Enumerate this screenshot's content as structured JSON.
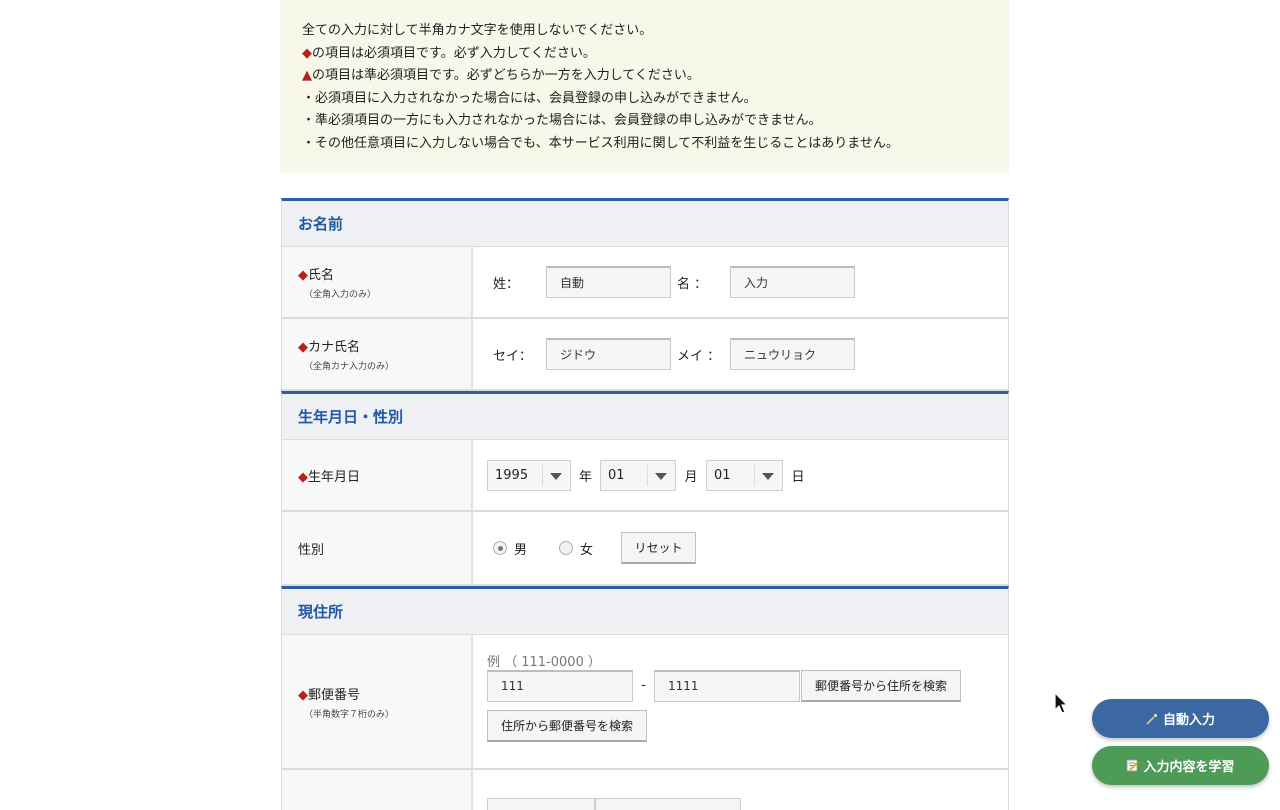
{
  "notice": {
    "line1": "全ての入力に対して半角カナ文字を使用しないでください。",
    "line2_mark": "◆",
    "line2": "の項目は必須項目です。必ず入力してください。",
    "line3_mark": "▲",
    "line3": "の項目は準必須項目です。必ずどちらか一方を入力してください。",
    "line4": "・必須項目に入力されなかった場合には、会員登録の申し込みができません。",
    "line5": "・準必須項目の一方にも入力されなかった場合には、会員登録の申し込みができません。",
    "line6": "・その他任意項目に入力しない場合でも、本サービス利用に関して不利益を生じることはありません。"
  },
  "sections": {
    "name": "お名前",
    "birth": "生年月日・性別",
    "address": "現住所"
  },
  "name_row": {
    "mark": "◆",
    "label": "氏名",
    "sub": "（全角入力のみ）",
    "sei_label": "姓：",
    "sei_value": "自動",
    "mei_label": "名 ：",
    "mei_value": "入力"
  },
  "kana_row": {
    "mark": "◆",
    "label": "カナ氏名",
    "sub": "（全角カナ入力のみ）",
    "sei_label": "セイ：",
    "sei_value": "ジドウ",
    "mei_label": "メイ ：",
    "mei_value": "ニュウリョク"
  },
  "birth_row": {
    "mark": "◆",
    "label": "生年月日",
    "year": "1995",
    "year_unit": "年",
    "month": "01",
    "month_unit": "月",
    "day": "01",
    "day_unit": "日"
  },
  "gender_row": {
    "label": "性別",
    "male": "男",
    "female": "女",
    "reset": "リセット",
    "selected": "男"
  },
  "zip_row": {
    "mark": "◆",
    "label": "郵便番号",
    "sub": "（半角数字７桁のみ）",
    "example": "例 （ 111-0000 ）",
    "zip1": "111",
    "dash": "-",
    "zip2": "1111",
    "search_by_zip": "郵便番号から住所を検索",
    "search_by_address": "住所から郵便番号を検索"
  },
  "fab": {
    "auto_icon": "magic-wand-icon",
    "auto_label": "自動入力",
    "learn_icon": "memo-icon",
    "learn_label": "入力内容を学習"
  },
  "colors": {
    "accent_blue": "#2c5ea8",
    "required_red": "#b8201a",
    "fab_blue": "#3b67a3",
    "fab_green": "#4e9a57"
  }
}
